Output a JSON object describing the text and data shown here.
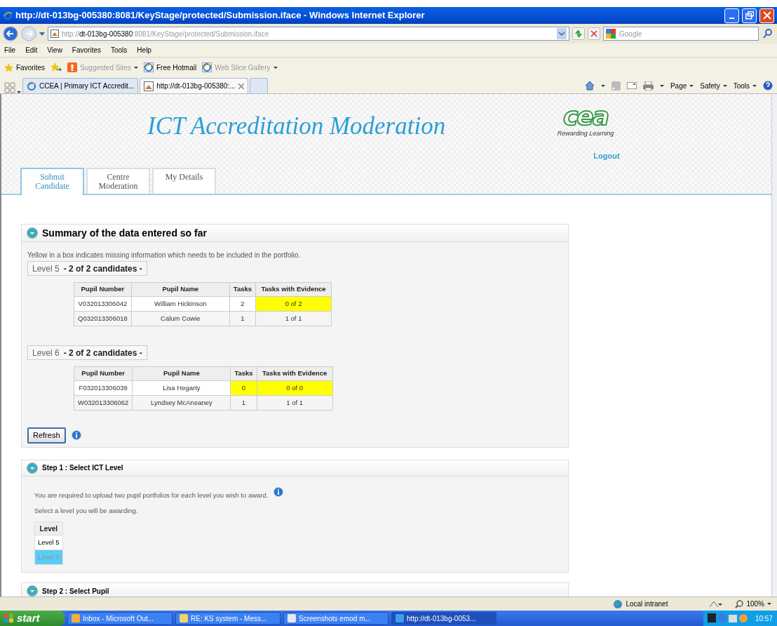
{
  "window": {
    "title": "http://dt-013bg-005380:8081/KeyStage/protected/Submission.iface - Windows Internet Explorer"
  },
  "address_bar": {
    "url_parts": [
      {
        "text": "http://",
        "emphasized": false
      },
      {
        "text": "dt-013bg-005380",
        "emphasized": true
      },
      {
        "text": ":8081/KeyStage/protected/Submission.iface",
        "emphasized": false
      }
    ]
  },
  "search": {
    "placeholder": "Google"
  },
  "menu": [
    "File",
    "Edit",
    "View",
    "Favorites",
    "Tools",
    "Help"
  ],
  "favorites_bar": {
    "label": "Favorites",
    "links": [
      {
        "label": "Suggested Sites",
        "disabled": true,
        "dropdown": true
      },
      {
        "label": "Free Hotmail",
        "disabled": false,
        "dropdown": false
      },
      {
        "label": "Web Slice Gallery",
        "disabled": true,
        "dropdown": true
      }
    ]
  },
  "browser_tabs": [
    {
      "label": "CCEA | Primary ICT Accredit...",
      "selected": false
    },
    {
      "label": "http://dt-013bg-005380:...",
      "selected": true
    }
  ],
  "command_bar": [
    "Page",
    "Safety",
    "Tools"
  ],
  "page": {
    "title": "ICT Accreditation Moderation",
    "logo_text": "cea",
    "logo_tagline": "Rewarding Learning",
    "logout": "Logout",
    "tabs": [
      {
        "label": "Submit Candidate",
        "selected": true
      },
      {
        "label": "Centre Moderation",
        "selected": false
      },
      {
        "label": "My Details",
        "selected": false
      }
    ],
    "summary": {
      "title": "Summary of the data entered so far",
      "note": "Yellow in a box indicates missing information which needs to be included in the portfolio.",
      "levels": [
        {
          "level": "Level 5",
          "count": "- 2 of 2 candidates -",
          "columns": [
            "Pupil Number",
            "Pupil Name",
            "Tasks",
            "Tasks with Evidence"
          ],
          "rows": [
            {
              "pupil_number": "V032013306042",
              "pupil_name": "William Hickinson",
              "tasks": "2",
              "tasks_missing": false,
              "evidence": "0 of 2",
              "evidence_missing": true
            },
            {
              "pupil_number": "Q032013306018",
              "pupil_name": "Calum Cowie",
              "tasks": "1",
              "tasks_missing": false,
              "evidence": "1 of 1",
              "evidence_missing": false
            }
          ]
        },
        {
          "level": "Level 6",
          "count": "- 2 of 2 candidates -",
          "columns": [
            "Pupil Number",
            "Pupil Name",
            "Tasks",
            "Tasks with Evidence"
          ],
          "rows": [
            {
              "pupil_number": "F032013306039",
              "pupil_name": "Lisa Hegarty",
              "tasks": "0",
              "tasks_missing": true,
              "evidence": "0 of 0",
              "evidence_missing": true
            },
            {
              "pupil_number": "W032013306062",
              "pupil_name": "Lyndsey McAneaney",
              "tasks": "1",
              "tasks_missing": false,
              "evidence": "1 of 1",
              "evidence_missing": false
            }
          ]
        }
      ],
      "refresh": "Refresh"
    },
    "step1": {
      "title": "Step 1 : Select ICT Level",
      "text": "You are required to upload two pupil portfolios for each level you wish to award.",
      "prompt": "Select a level you will be awarding.",
      "column": "Level",
      "options": [
        {
          "label": "Level 5",
          "selected": false
        },
        {
          "label": "Level 6",
          "selected": true
        }
      ]
    },
    "step2": {
      "title": "Step 2 : Select Pupil"
    }
  },
  "status_bar": {
    "zone": "Local intranet",
    "zoom": "100%"
  },
  "taskbar": {
    "start": "start",
    "tasks": [
      {
        "label": "Inbox - Microsoft Out...",
        "selected": false
      },
      {
        "label": "RE: KS system - Mess...",
        "selected": false
      },
      {
        "label": "Screenshots emod m...",
        "selected": false
      },
      {
        "label": "http://dt-013bg-0053...",
        "selected": true
      }
    ],
    "clock": "10:57"
  }
}
